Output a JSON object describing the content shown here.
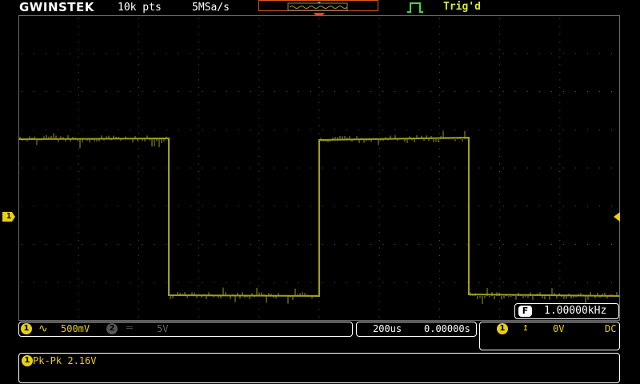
{
  "header": {
    "brand": "GWINSTEK",
    "record_length": "10k pts",
    "sample_rate": "5MSa/s",
    "trigger_status": "Trig'd",
    "trigger_icon": "trigger-pulse-icon"
  },
  "colors": {
    "ch1": "#e8cf1c",
    "trace": "#a39f24",
    "grid": "#5a5a5a",
    "trigger_position": "#f0441e"
  },
  "channel1": {
    "marker": "1",
    "coupling_icon": "ac-coupling-icon",
    "coupling_glyph": "∿",
    "scale": "500mV"
  },
  "channel2": {
    "marker": "2",
    "coupling_icon": "dc-coupling-icon",
    "coupling_glyph": "═",
    "scale": "5V"
  },
  "timebase": {
    "scale": "200us",
    "offset": "0.00000s"
  },
  "trigger": {
    "source": "1",
    "slope_glyph": "↥",
    "level": "0V",
    "coupling": "DC"
  },
  "frequency": {
    "icon_label": "F",
    "value": "1.00000kHz"
  },
  "measurement": {
    "source": "1",
    "text": "Pk-Pk 2.16V"
  }
}
